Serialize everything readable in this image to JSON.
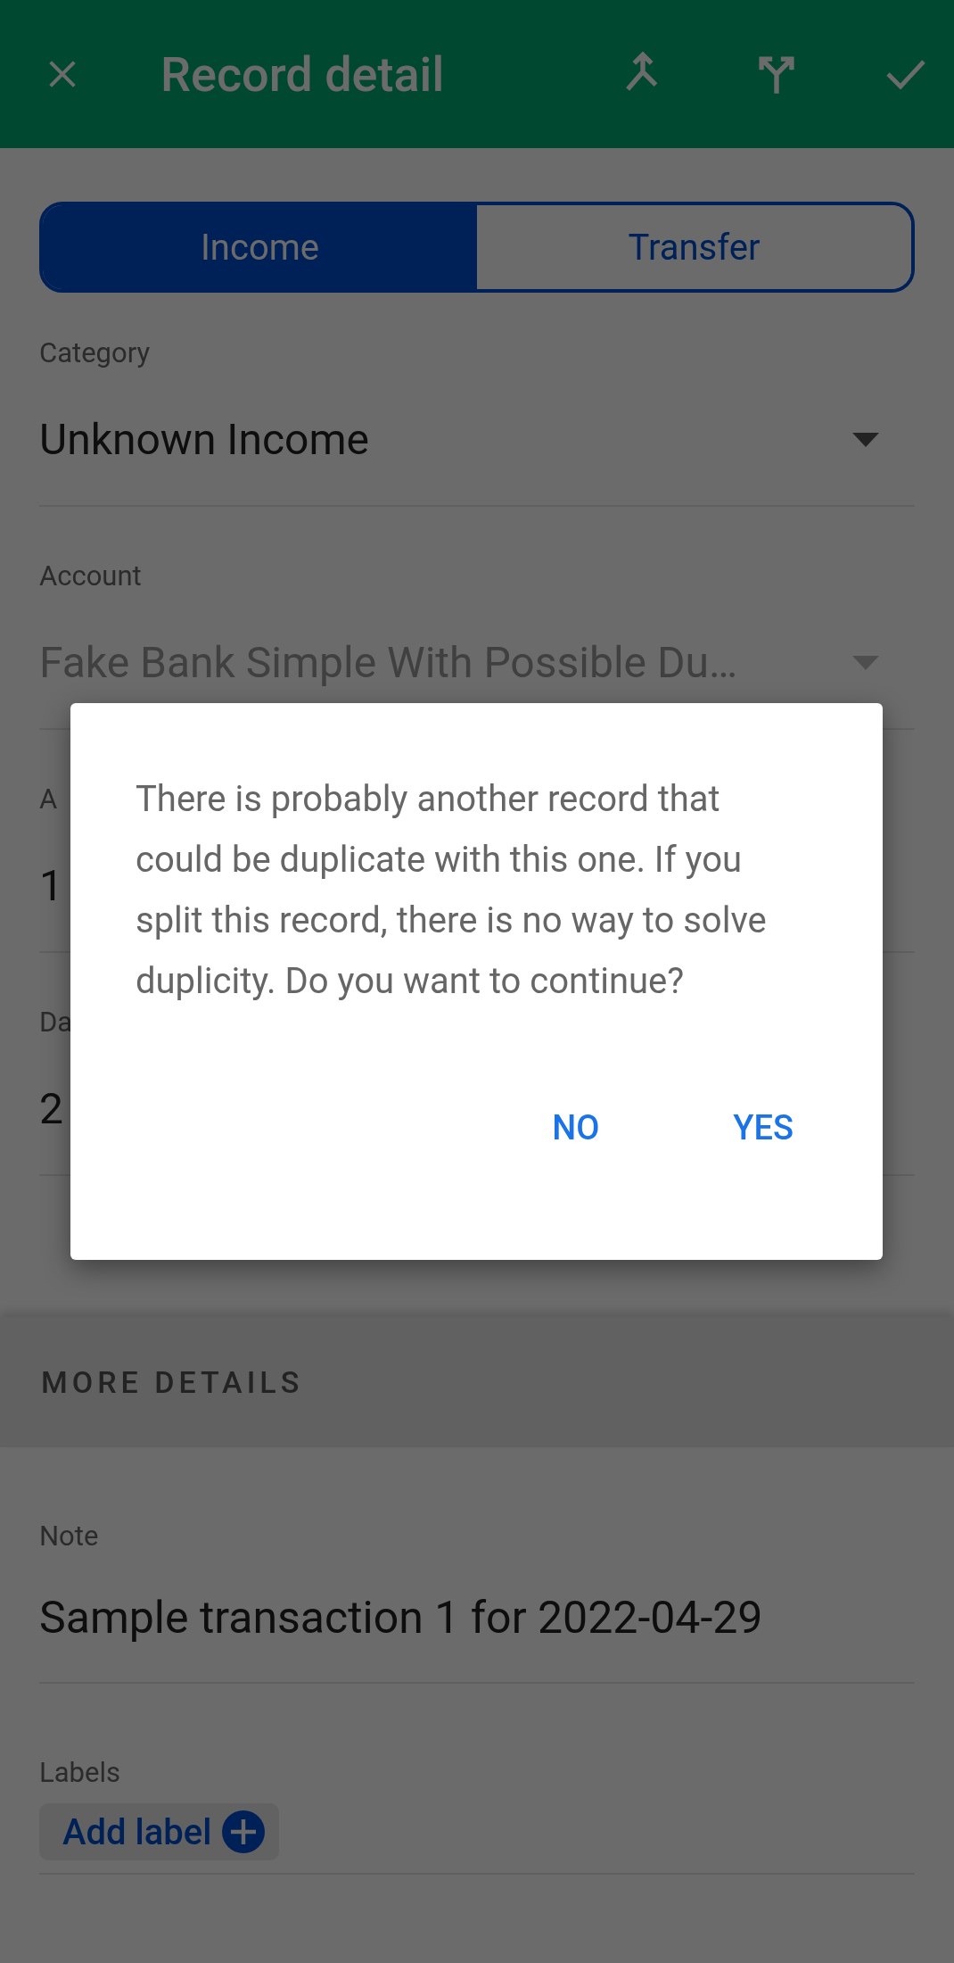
{
  "app_bar": {
    "title": "Record detail"
  },
  "tabs": [
    {
      "label": "Income",
      "selected": true
    },
    {
      "label": "Transfer",
      "selected": false
    }
  ],
  "fields": [
    {
      "kind": "dropdown",
      "label": "Category",
      "value": "Unknown Income",
      "disabled": false
    },
    {
      "kind": "dropdown",
      "label": "Account",
      "value": "Fake Bank Simple With Possible Du…",
      "disabled": true
    },
    {
      "kind": "text",
      "label": "A",
      "value": "1"
    },
    {
      "kind": "text",
      "label": "Da",
      "value": "2"
    }
  ],
  "section_header": "MORE DETAILS",
  "note": {
    "label": "Note",
    "value": "Sample transaction 1 for 2022-04-29"
  },
  "labels": {
    "label": "Labels",
    "button": "Add label"
  },
  "dialog": {
    "message": "There is probably another record that could be duplicate with this one. If you split this record, there is no way to solve duplicity. Do you want to continue?",
    "buttons": [
      "NO",
      "YES"
    ]
  }
}
